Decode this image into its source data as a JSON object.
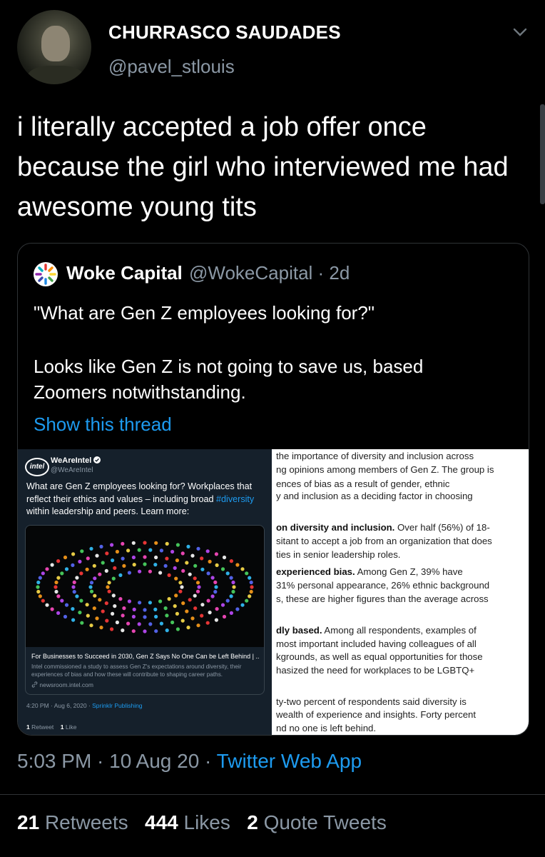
{
  "tweet": {
    "author_name": "CHURRASCO SAUDADES",
    "author_handle": "@pavel_stlouis",
    "text": "i literally accepted a job offer once because the girl who interviewed me had awesome young tits",
    "timestamp": "5:03 PM · 10 Aug 20 · ",
    "source": "Twitter Web App",
    "stats": {
      "retweets_count": "21",
      "retweets_label": "Retweets",
      "likes_count": "444",
      "likes_label": "Likes",
      "quotes_count": "2",
      "quotes_label": "Quote Tweets"
    }
  },
  "quoted": {
    "name": "Woke Capital",
    "handle_time": "@WokeCapital · 2d",
    "line1": "\"What are Gen Z employees looking for?\"",
    "line2": "Looks like Gen Z is not going to save us, based Zoomers notwithstanding.",
    "show_thread": "Show this thread",
    "embedded_tweet": {
      "logo_text": "intel",
      "name": "WeAreIntel",
      "handle": "@WeAreIntel",
      "text_part1": "What are Gen Z employees looking for? Workplaces that reflect their ethics and values – including broad ",
      "hashtag": "#diversity",
      "text_part2": " within leadership and peers. Learn more:",
      "card_title": "For Businesses to Succeed in 2030, Gen Z Says No One Can be Left Behind | ...",
      "card_desc": "Intel commissioned a study to assess Gen Z's expectations around diversity, their experiences of bias and how these will contribute to shaping career paths.",
      "card_link": "newsroom.intel.com",
      "time": "4:20 PM · Aug 6, 2020 · ",
      "time_source": "Sprinklr Publishing",
      "retweets": "1",
      "retweets_label": "Retweet",
      "likes": "1",
      "likes_label": "Like"
    },
    "article_lines": [
      {
        "bold": "",
        "text": "the importance of diversity and inclusion across"
      },
      {
        "bold": "",
        "text": "ng opinions among members of Gen Z. The group is"
      },
      {
        "bold": "",
        "text": "ences of bias as a result of gender, ethnic"
      },
      {
        "bold": "",
        "text": "y and inclusion as a deciding factor in choosing"
      },
      {
        "bold": "on diversity and inclusion.",
        "text": " Over half (56%) of 18-"
      },
      {
        "bold": "",
        "text": "sitant to accept a job from an organization that does"
      },
      {
        "bold": "",
        "text": "ties in senior leadership roles."
      },
      {
        "bold": "experienced bias.",
        "text": " Among Gen Z, 39% have"
      },
      {
        "bold": "",
        "text": "31% personal appearance, 26% ethnic background"
      },
      {
        "bold": "",
        "text": "s, these are higher figures than the average across"
      },
      {
        "bold": "dly based.",
        "text": " Among all respondents, examples of"
      },
      {
        "bold": "",
        "text": "most important included having colleagues of all"
      },
      {
        "bold": "",
        "text": "kgrounds, as well as equal opportunities for those"
      },
      {
        "bold": "",
        "text": "hasized the need for workplaces to be LGBTQ+"
      },
      {
        "bold": "",
        "text": "ty-two percent of respondents said diversity is"
      },
      {
        "bold": "",
        "text": "wealth of experience and insights. Forty percent"
      },
      {
        "bold": "",
        "text": "nd no one is left behind."
      }
    ]
  },
  "colors": {
    "background": "#000000",
    "secondary_text": "#8b98a5",
    "link": "#1d9bf0",
    "border": "#2f3336"
  },
  "icons": [
    "chevron-down-icon",
    "woke-capital-logo-icon",
    "intel-logo-icon",
    "verified-badge-icon",
    "link-icon"
  ]
}
